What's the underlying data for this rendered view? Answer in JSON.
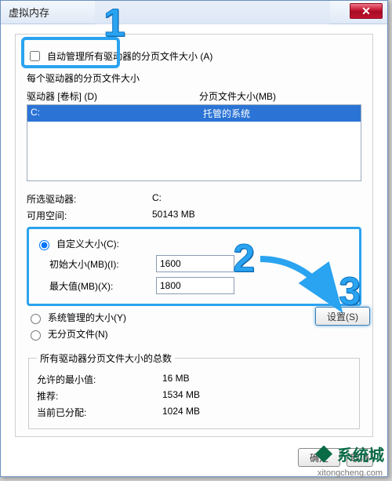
{
  "window": {
    "title": "虚拟内存",
    "close_glyph": "✕"
  },
  "autoManage": {
    "label": "自动管理所有驱动器的分页文件大小 (A)",
    "checked": false
  },
  "sectionLabel": "每个驱动器的分页文件大小",
  "headers": {
    "drive": "驱动器 [卷标] (D)",
    "paging": "分页文件大小(MB)"
  },
  "driveList": [
    {
      "drive": "C:",
      "paging": "托管的系统",
      "selected": true
    }
  ],
  "selected": {
    "driveLabel": "所选驱动器:",
    "driveValue": "C:",
    "spaceLabel": "可用空间:",
    "spaceValue": "50143 MB"
  },
  "sizeOptions": {
    "custom": {
      "label": "自定义大小(C):",
      "selected": true
    },
    "initialLabel": "初始大小(MB)(I):",
    "initialValue": "1600",
    "maxLabel": "最大值(MB)(X):",
    "maxValue": "1800",
    "system": {
      "label": "系统管理的大小(Y)",
      "selected": false
    },
    "none": {
      "label": "无分页文件(N)",
      "selected": false
    }
  },
  "setButton": "设置(S)",
  "totals": {
    "title": "所有驱动器分页文件大小的总数",
    "minLabel": "允许的最小值:",
    "minValue": "16 MB",
    "recLabel": "推荐:",
    "recValue": "1534 MB",
    "curLabel": "当前已分配:",
    "curValue": "1024 MB"
  },
  "buttons": {
    "ok": "确定",
    "cancel": "取消"
  },
  "annotations": {
    "n1": "1",
    "n2": "2",
    "n3": "3"
  },
  "watermark": {
    "text": "系统城",
    "url": "xitongcheng.com"
  }
}
